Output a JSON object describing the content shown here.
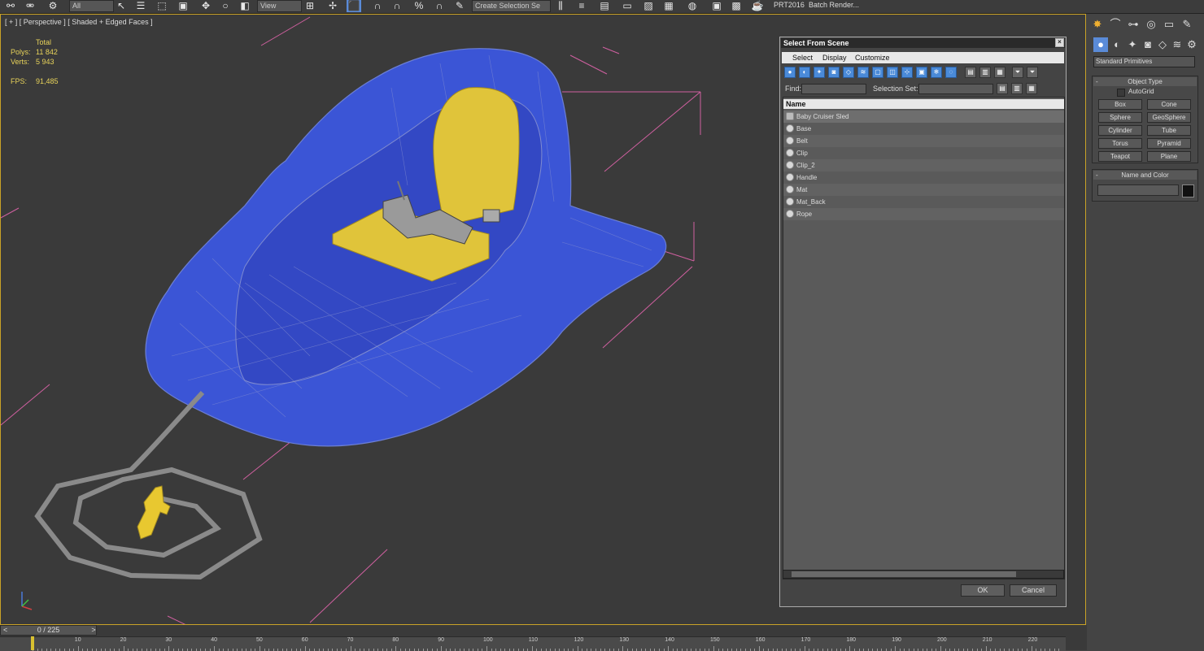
{
  "toolbar": {
    "dropdowns": [
      "All",
      "View",
      "Create Selection Se"
    ],
    "right_items": [
      "PRT2016",
      "Batch Render..."
    ]
  },
  "viewport": {
    "label": "[ + ] [ Perspective ] [ Shaded + Edged Faces ]",
    "stats": {
      "total_label": "Total",
      "polys_label": "Polys:",
      "polys_value": "11 842",
      "verts_label": "Verts:",
      "verts_value": "5 943",
      "fps_label": "FPS:",
      "fps_value": "91,485"
    },
    "colors": {
      "sled_body": "#3b55d6",
      "seat": "#e0c43a",
      "rope": "#8a8a8a",
      "handle": "#e8c830",
      "highlight_border": "#c9a227"
    }
  },
  "dialog": {
    "title": "Select From Scene",
    "close_label": "×",
    "menu": [
      "Select",
      "Display",
      "Customize"
    ],
    "find_label": "Find:",
    "selection_set_label": "Selection Set:",
    "list_header": "Name",
    "items": [
      "Baby Cruiser Sled",
      "Base",
      "Belt",
      "Clip",
      "Clip_2",
      "Handle",
      "Mat",
      "Mat_Back",
      "Rope"
    ],
    "ok_label": "OK",
    "cancel_label": "Cancel"
  },
  "command_panel": {
    "dropdown": "Standard Primitives",
    "object_type_title": "Object Type",
    "autogrid_label": "AutoGrid",
    "primitives": [
      "Box",
      "Cone",
      "Sphere",
      "GeoSphere",
      "Cylinder",
      "Tube",
      "Torus",
      "Pyramid",
      "Teapot",
      "Plane"
    ],
    "name_color_title": "Name and Color",
    "object_color": "#111111"
  },
  "timeline": {
    "frame_display": "0 / 225",
    "ticks": [
      "0",
      "10",
      "20",
      "30",
      "40",
      "50",
      "60",
      "70",
      "80",
      "90",
      "100",
      "110",
      "120",
      "130",
      "140",
      "150",
      "160",
      "170",
      "180",
      "190",
      "200",
      "210",
      "220"
    ]
  }
}
